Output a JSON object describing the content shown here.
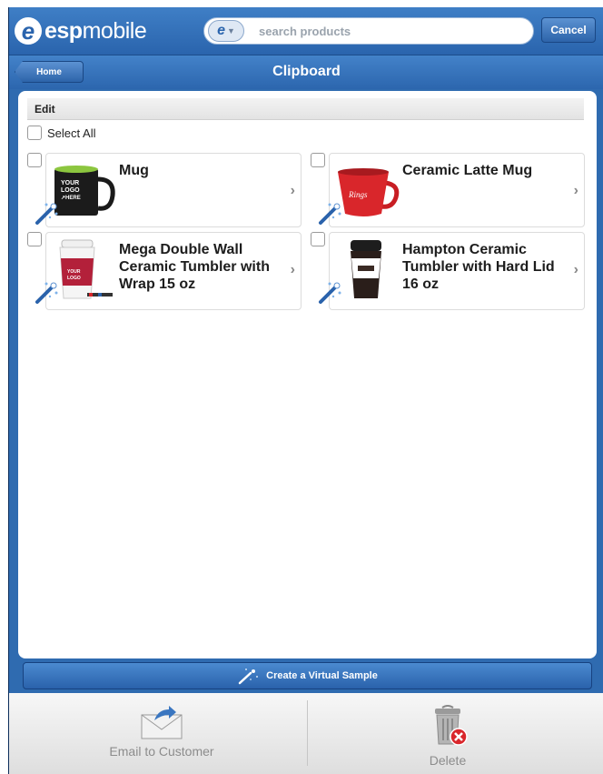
{
  "app": {
    "logo_prefix": "esp",
    "logo_suffix": "mobile"
  },
  "search": {
    "placeholder": "search products",
    "cancel_label": "Cancel"
  },
  "nav": {
    "back_label": "Home",
    "title": "Clipboard"
  },
  "edit": {
    "label": "Edit",
    "select_all_label": "Select All"
  },
  "products": [
    {
      "title": "Mug",
      "image": "black-mug-your-logo-here"
    },
    {
      "title": "Ceramic Latte Mug",
      "image": "red-latte-mug"
    },
    {
      "title": "Mega Double Wall Ceramic Tumbler with Wrap 15 oz",
      "image": "white-tumbler-red-wrap"
    },
    {
      "title": "Hampton Ceramic Tumbler with Hard Lid 16 oz",
      "image": "black-white-tumbler"
    }
  ],
  "virtual_sample": {
    "label": "Create a Virtual Sample"
  },
  "toolbar": {
    "email_label": "Email to Customer",
    "delete_label": "Delete"
  },
  "colors": {
    "primary": "#2f6bb0",
    "accent_red": "#d9262b"
  }
}
